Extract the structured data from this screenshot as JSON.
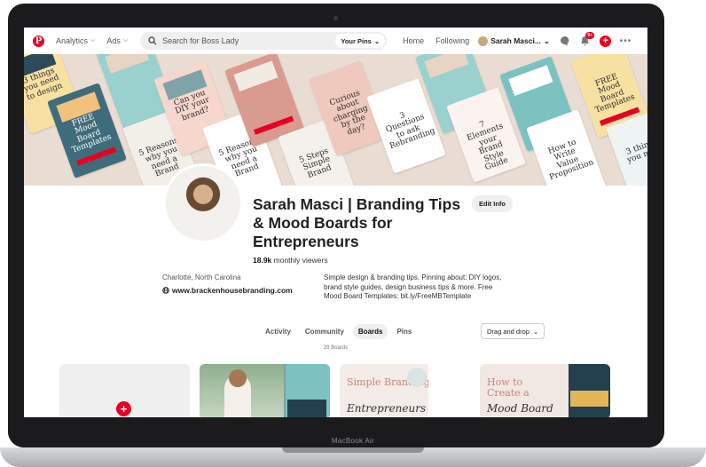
{
  "device": {
    "brand": "MacBook Air"
  },
  "topbar": {
    "nav": [
      "Analytics",
      "Ads"
    ],
    "search_placeholder": "Search for Boss Lady",
    "search_scope": "Your Pins",
    "links": [
      "Home",
      "Following"
    ],
    "user_name": "Sarah Masci...",
    "notification_count": "9+"
  },
  "cover": {
    "pins": [
      "5 Reasons why you need a Brand",
      "Curious about charging by the day?",
      "3 Questions to ask Rebranding",
      "7 Elements your Brand Style Guide",
      "How to Write Value Proposition",
      "5 Steps Simple Brand",
      "FREE Mood Board Templates",
      "Can you DIY your brand?"
    ]
  },
  "profile": {
    "name": "Sarah Masci | Branding Tips & Mood Boards for Entrepreneurs",
    "edit_label": "Edit Info",
    "viewers_count": "18.9k",
    "viewers_label": " monthly viewers",
    "location": "Charlotte, North Carolina",
    "website": "www.brackenhousebranding.com",
    "bio": "Simple design & branding tips. Pinning about: DIY logos, brand style guides, design business tips & more. Free Mood Board Templates: bit.ly/FreeMBTemplate"
  },
  "tabs": [
    "Activity",
    "Community",
    "Boards",
    "Pins"
  ],
  "active_tab": "Boards",
  "sort_label": "Drag and drop",
  "board_count": "29 Boards",
  "boards": [
    {
      "title_a": "Simple Branding for",
      "title_b": "Entrepreneurs"
    },
    {
      "title_a": "How to Create a",
      "title_b": "Mood Board"
    }
  ],
  "colors": {
    "accent": "#e60023"
  }
}
